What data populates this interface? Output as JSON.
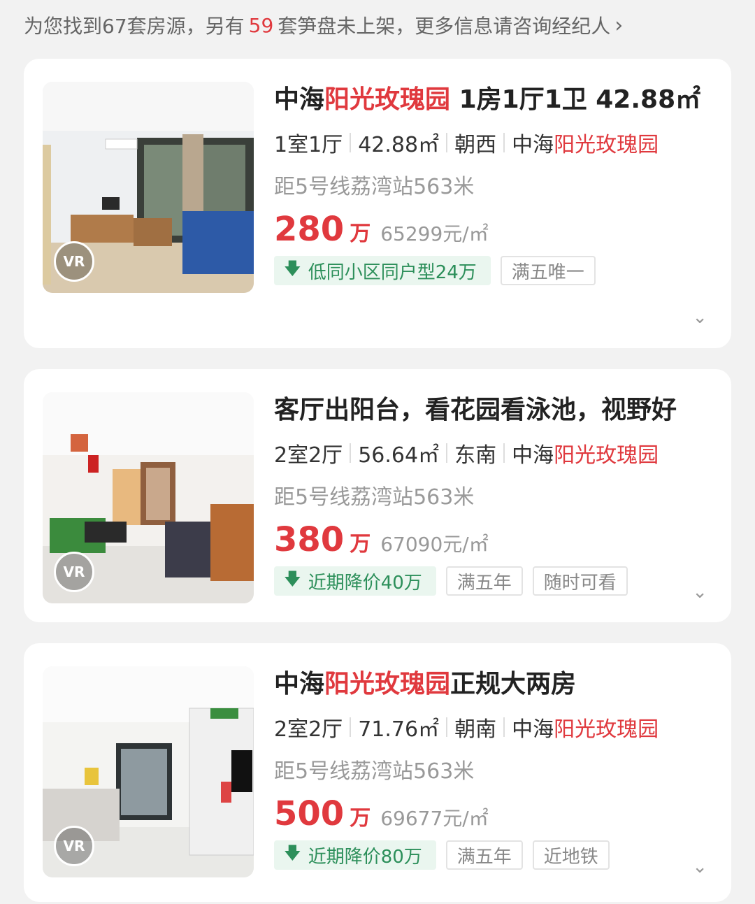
{
  "summary": {
    "prefix": "为您找到67套房源，另有",
    "count_red": "59",
    "suffix": "套笋盘未上架，更多信息请咨询经纪人"
  },
  "listings": [
    {
      "title_pre": "中海",
      "title_red": "阳光玫瑰园",
      "title_post": " 1房1厅1卫 42.88㎡",
      "layout": "1室1厅",
      "area": "42.88㎡",
      "orientation": "朝西",
      "community_pre": "中海",
      "community_red": "阳光玫瑰园",
      "metro": "距5号线荔湾站563米",
      "price": "280",
      "price_unit": "万",
      "price_per_sqm": "65299元/㎡",
      "green_tag": "低同小区同户型24万",
      "tags": [
        "满五唯一"
      ],
      "vr_label": "VR"
    },
    {
      "title_pre": "客厅出阳台，看花园看泳池，视野好",
      "title_red": "",
      "title_post": "",
      "layout": "2室2厅",
      "area": "56.64㎡",
      "orientation": "东南",
      "community_pre": "中海",
      "community_red": "阳光玫瑰园",
      "metro": "距5号线荔湾站563米",
      "price": "380",
      "price_unit": "万",
      "price_per_sqm": "67090元/㎡",
      "green_tag": "近期降价40万",
      "tags": [
        "满五年",
        "随时可看"
      ],
      "vr_label": "VR"
    },
    {
      "title_pre": "中海",
      "title_red": "阳光玫瑰园",
      "title_post": "正规大两房",
      "layout": "2室2厅",
      "area": "71.76㎡",
      "orientation": "朝南",
      "community_pre": "中海",
      "community_red": "阳光玫瑰园",
      "metro": "距5号线荔湾站563米",
      "price": "500",
      "price_unit": "万",
      "price_per_sqm": "69677元/㎡",
      "green_tag": "近期降价80万",
      "tags": [
        "满五年",
        "近地铁"
      ],
      "vr_label": "VR"
    }
  ]
}
